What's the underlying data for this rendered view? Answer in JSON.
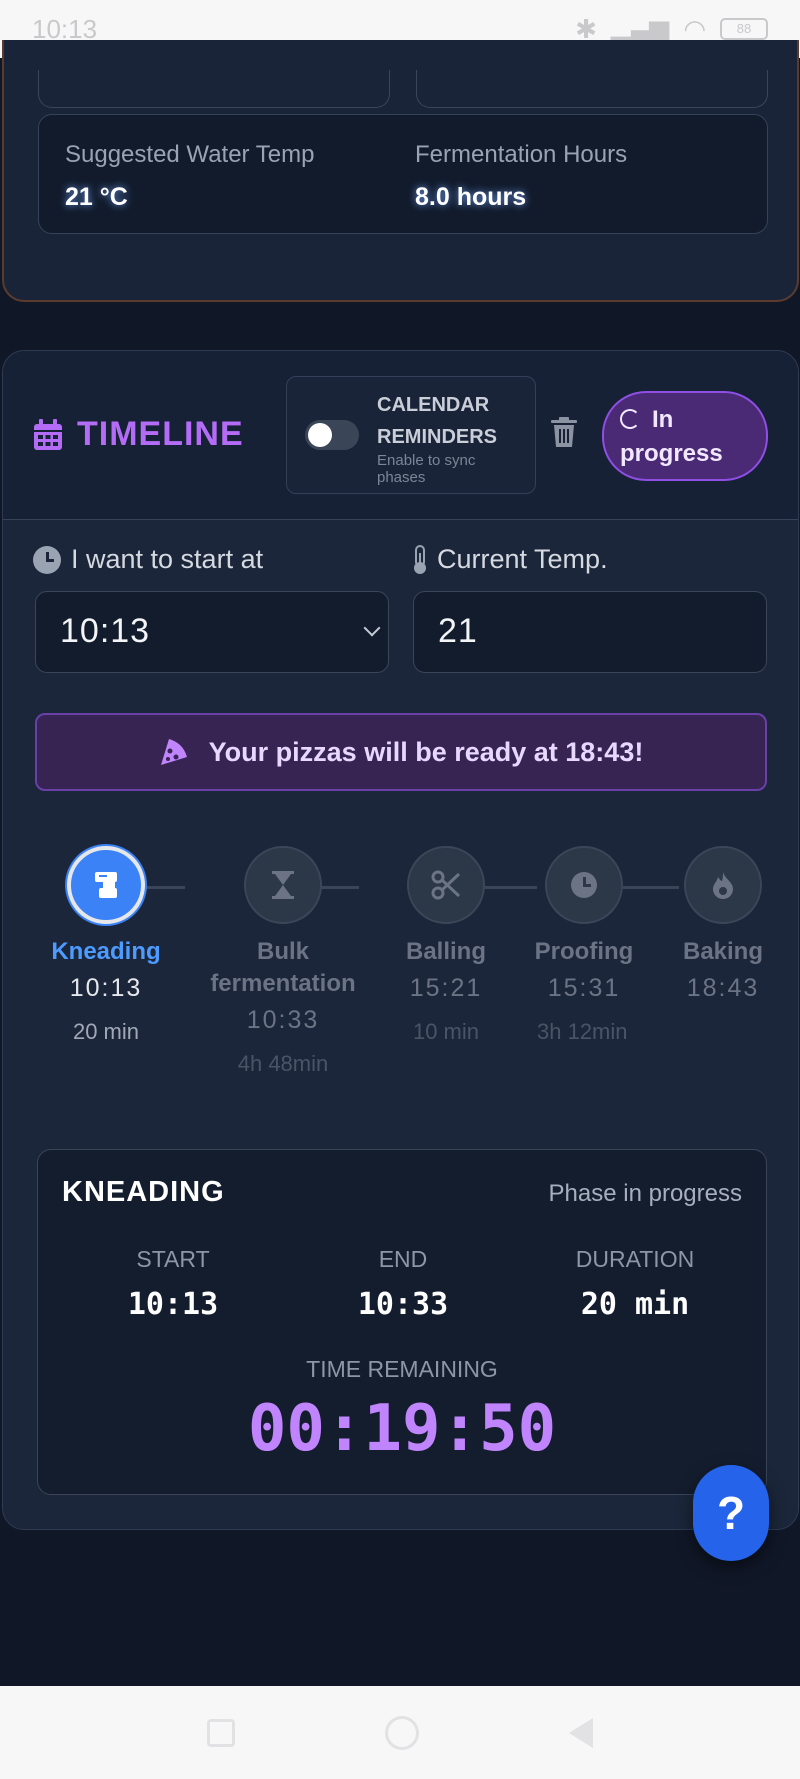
{
  "status_bar": {
    "time": "10:13",
    "battery": "88"
  },
  "info": {
    "water_temp_label": "Suggested Water Temp",
    "water_temp_value": "21 °C",
    "fermentation_label": "Fermentation Hours",
    "fermentation_value": "8.0 hours"
  },
  "timeline": {
    "title": "TIMELINE",
    "reminders_title": "CALENDAR REMINDERS",
    "reminders_sub": "Enable to sync phases",
    "reminders_enabled": false,
    "status": "In progress",
    "start_label": "I want to start at",
    "start_value": "10:13",
    "temp_label": "Current Temp.",
    "temp_value": "21",
    "ready_text": "Your pizzas will be ready at 18:43!",
    "steps": [
      {
        "name": "Kneading",
        "time": "10:13",
        "duration": "20 min",
        "icon": "mixer-icon",
        "active": true
      },
      {
        "name": "Bulk fermentation",
        "time": "10:33",
        "duration": "4h 48min",
        "icon": "hourglass-icon",
        "active": false
      },
      {
        "name": "Balling",
        "time": "15:21",
        "duration": "10 min",
        "icon": "scissors-icon",
        "active": false
      },
      {
        "name": "Proofing",
        "time": "15:31",
        "duration": "3h 12min",
        "icon": "clock-icon",
        "active": false
      },
      {
        "name": "Baking",
        "time": "18:43",
        "duration": "",
        "icon": "fire-icon",
        "active": false
      }
    ]
  },
  "phase": {
    "title": "KNEADING",
    "status": "Phase in progress",
    "start_label": "START",
    "start_value": "10:13",
    "end_label": "END",
    "end_value": "10:33",
    "duration_label": "DURATION",
    "duration_value": "20 min",
    "remaining_label": "TIME REMAINING",
    "remaining_value": "00:19:50"
  },
  "help_label": "?",
  "colors": {
    "accent": "#b46cf6",
    "active_step": "#3b82f6",
    "banner": "#372453"
  }
}
